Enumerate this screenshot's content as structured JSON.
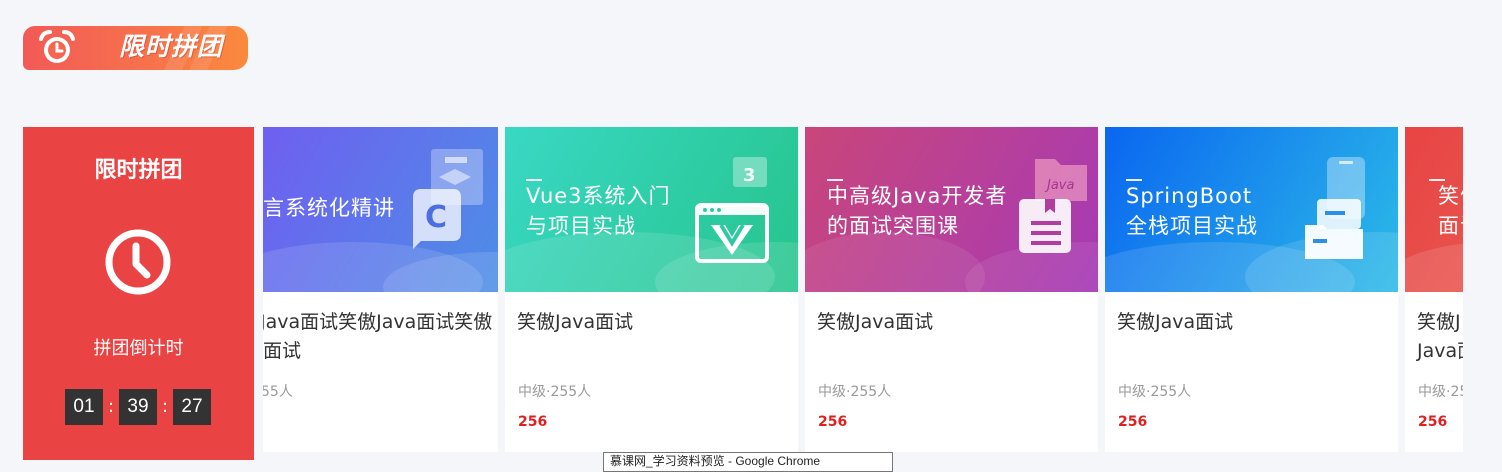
{
  "section": {
    "title": "限时拼团",
    "icon": "alarm-clock-icon",
    "gradient": [
      "#f25a56",
      "#fb8a3c"
    ]
  },
  "countdown": {
    "title": "限时拼团",
    "icon": "clock-icon",
    "subtitle": "拼团倒计时",
    "hours": "01",
    "minutes": "39",
    "seconds": "27",
    "separator": ":",
    "background": "#e94443"
  },
  "courses": [
    {
      "cover_lines": [
        "言系统化精讲"
      ],
      "cover_icon": "c-language-icon",
      "title_lines": [
        "Java面试笑傲Java面试笑傲",
        "面试"
      ],
      "meta": "55人",
      "price": "",
      "colors": [
        "#6a63f0",
        "#4a90e6"
      ]
    },
    {
      "cover_lines": [
        "Vue3系统入门",
        "与项目实战"
      ],
      "cover_icon": "vue-window-icon",
      "title_lines": [
        "笑傲Java面试"
      ],
      "meta": "中级·255人",
      "price": "256",
      "colors": [
        "#35d6be",
        "#27c48f"
      ]
    },
    {
      "cover_lines": [
        "中高级Java开发者",
        "的面试突围课"
      ],
      "cover_icon": "java-folder-icon",
      "title_lines": [
        "笑傲Java面试"
      ],
      "meta": "中级·255人",
      "price": "256",
      "colors": [
        "#c6457a",
        "#a93ab4"
      ]
    },
    {
      "cover_lines": [
        "SpringBoot",
        "全栈项目实战"
      ],
      "cover_icon": "device-stack-icon",
      "title_lines": [
        "笑傲Java面试"
      ],
      "meta": "中级·255人",
      "price": "256",
      "colors": [
        "#0c6ff0",
        "#2ab8ea"
      ]
    },
    {
      "cover_lines": [
        "笑傲",
        "面试"
      ],
      "cover_icon": "",
      "title_lines": [
        "笑傲J",
        "Java面"
      ],
      "meta": "中级·25",
      "price": "256",
      "colors": [
        "#e84545",
        "#e86a5a"
      ]
    }
  ],
  "tooltip": {
    "text": "慕课网_学习资料预览 - Google Chrome"
  }
}
